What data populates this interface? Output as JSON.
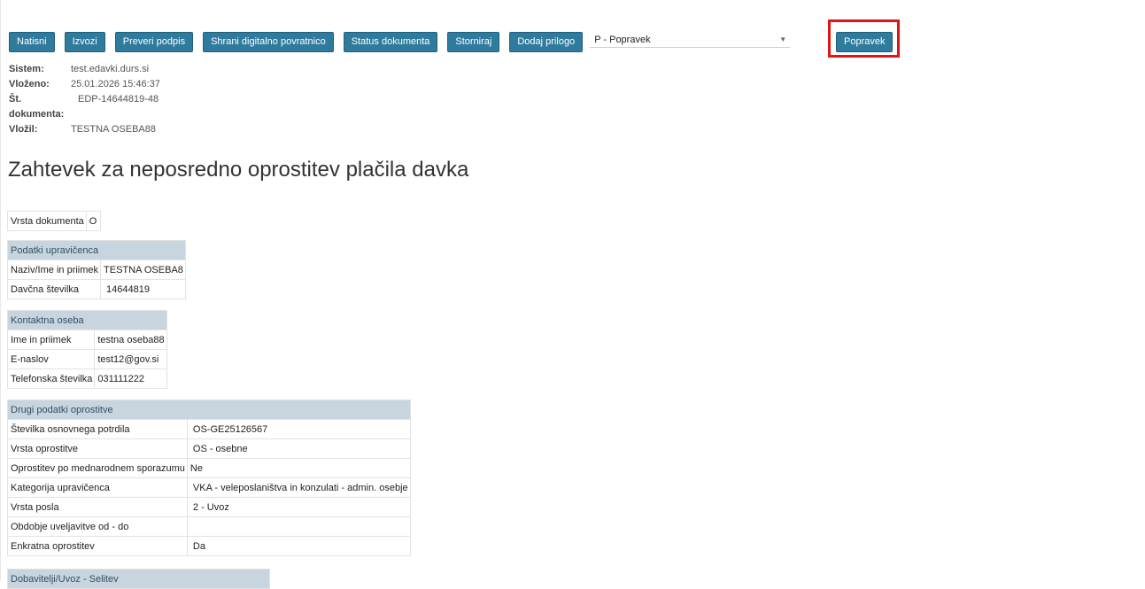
{
  "toolbar": {
    "buttons": [
      "Natisni",
      "Izvozi",
      "Preveri podpis",
      "Shrani digitalno povratnico",
      "Status dokumenta",
      "Storniraj",
      "Dodaj prilogo"
    ],
    "select_value": "P - Popravek",
    "popravek_label": "Popravek",
    "highlight_color": "#e01515",
    "button_color": "#2f7b9d"
  },
  "meta": {
    "sistem_label": "Sistem:",
    "sistem": "test.edavki.durs.si",
    "vlozeno_label": "Vloženo:",
    "vlozeno": "25.01.2026 15:46:37",
    "st_label": "Št. dokumenta:",
    "st": "EDP-14644819-48",
    "vlozil_label": "Vložil:",
    "vlozil": "TESTNA OSEBA88"
  },
  "title": "Zahtevek za neposredno oprostitev plačila davka",
  "vrsta_dokumenta": {
    "label": "Vrsta dokumenta",
    "value": "O"
  },
  "upravicenec": {
    "header": "Podatki upravičenca",
    "rows": [
      {
        "label": "Naziv/Ime in priimek",
        "value": "TESTNA OSEBA8"
      },
      {
        "label": "Davčna številka",
        "value": "14644819"
      }
    ]
  },
  "kontakt": {
    "header": "Kontaktna oseba",
    "rows": [
      {
        "label": "Ime in priimek",
        "value": "testna oseba88"
      },
      {
        "label": "E-naslov",
        "value": "test12@gov.si"
      },
      {
        "label": "Telefonska številka",
        "value": "031111222"
      }
    ]
  },
  "drugi": {
    "header": "Drugi podatki oprostitve",
    "rows": [
      {
        "label": "Številka osnovnega potrdila",
        "value": "OS-GE25126567"
      },
      {
        "label": "Vrsta oprostitve",
        "value": "OS - osebne"
      },
      {
        "label": "Oprostitev po mednarodnem sporazumu",
        "value": "Ne"
      },
      {
        "label": "Kategorija upravičenca",
        "value": "VKA - veleposlaništva in konzulati - admin. osebje"
      },
      {
        "label": "Vrsta posla",
        "value": "2 - Uvoz"
      },
      {
        "label": "Obdobje uveljavitve od - do",
        "value": ""
      },
      {
        "label": "Enkratna oprostitev",
        "value": "Da"
      }
    ]
  },
  "dobavitelji": {
    "header": "Dobavitelji/Uvoz - Selitev"
  }
}
